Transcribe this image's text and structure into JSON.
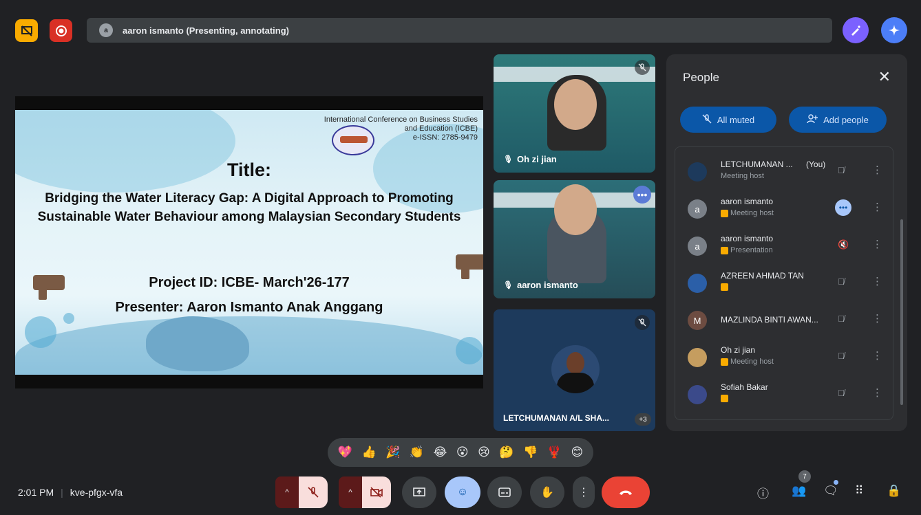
{
  "banner": {
    "avatar_letter": "a",
    "text": "aaron ismanto (Presenting, annotating)"
  },
  "slide": {
    "conf_line1": "International Conference on Business Studies",
    "conf_line2": "and Education (ICBE)",
    "conf_line3": "e-ISSN: 2785-9479",
    "title": "Title:",
    "subtitle": "Bridging the Water Literacy Gap: A Digital Approach to Promoting Sustainable Water Behaviour among Malaysian Secondary Students",
    "project_id": "Project ID: ICBE- March'26-177",
    "presenter": "Presenter: Aaron Ismanto Anak Anggang"
  },
  "tiles": [
    {
      "name": "Oh zi jian"
    },
    {
      "name": "aaron ismanto"
    },
    {
      "name": "LETCHUMANAN A/L SHA...",
      "extra": "+3"
    }
  ],
  "panel": {
    "title": "People",
    "all_muted": "All muted",
    "add_people": "Add people",
    "participants": [
      {
        "name": "LETCHUMANAN ...",
        "you": "(You)",
        "role": "Meeting host",
        "avatar": "",
        "avatar_color": "#1d3a5c"
      },
      {
        "name": "aaron ismanto",
        "role": "Meeting host",
        "avatar": "a",
        "avatar_color": "#7a8088"
      },
      {
        "name": "aaron ismanto",
        "role": "Presentation",
        "avatar": "a",
        "avatar_color": "#7a8088"
      },
      {
        "name": "AZREEN AHMAD TAN",
        "role": "",
        "avatar": "",
        "avatar_color": "#2b5fa8"
      },
      {
        "name": "MAZLINDA BINTI AWAN...",
        "role": "",
        "avatar": "M",
        "avatar_color": "#6d4c41"
      },
      {
        "name": "Oh zi jian",
        "role": "Meeting host",
        "avatar": "",
        "avatar_color": "#c59d5f"
      },
      {
        "name": "Sofiah Bakar",
        "role": "",
        "avatar": "",
        "avatar_color": "#3b4a8a"
      }
    ]
  },
  "reactions": [
    "💖",
    "👍",
    "🎉",
    "👏",
    "😂",
    "😮",
    "😢",
    "🤔",
    "👎",
    "🦞",
    "😊"
  ],
  "bottom": {
    "time": "2:01 PM",
    "meeting_code": "kve-pfgx-vfa",
    "people_count": "7"
  },
  "colors": {
    "accent": "#0b57a8",
    "end_call": "#ea4335",
    "background": "#202124"
  }
}
